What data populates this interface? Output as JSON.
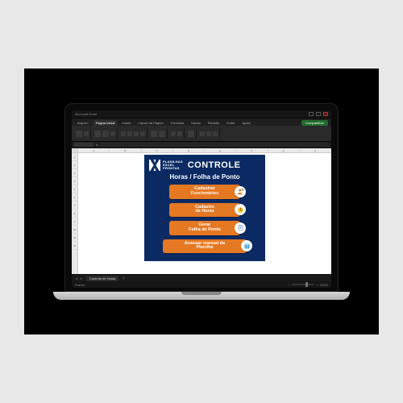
{
  "app": {
    "title": "Microsoft Excel",
    "menus": [
      "Arquivo",
      "Página Inicial",
      "Inserir",
      "Layout da Página",
      "Fórmulas",
      "Dados",
      "Revisão",
      "Exibir",
      "Ajuda"
    ],
    "share_label": "Compartilhar"
  },
  "sheet": {
    "tab_label": "Controle de Horas",
    "status": "Pronto",
    "zoom": "100%"
  },
  "panel": {
    "logo_lines": [
      "PLANILHAS",
      "EXCEL",
      "PRONTAS"
    ],
    "title": "CONTROLE",
    "subtitle": "Horas / Folha de Ponto",
    "buttons": [
      {
        "line1": "Cadastrar",
        "line2": "Funcionários",
        "icon": "user-plus",
        "size": "md"
      },
      {
        "line1": "Cadastro",
        "line2": "de Horas",
        "icon": "clock",
        "size": "md"
      },
      {
        "line1": "Gerar",
        "line2": "Folha de Ponto",
        "icon": "doc",
        "size": "md"
      },
      {
        "line1": "Acessar manual da",
        "line2": "Planilha",
        "icon": "book",
        "size": "lg"
      }
    ]
  }
}
